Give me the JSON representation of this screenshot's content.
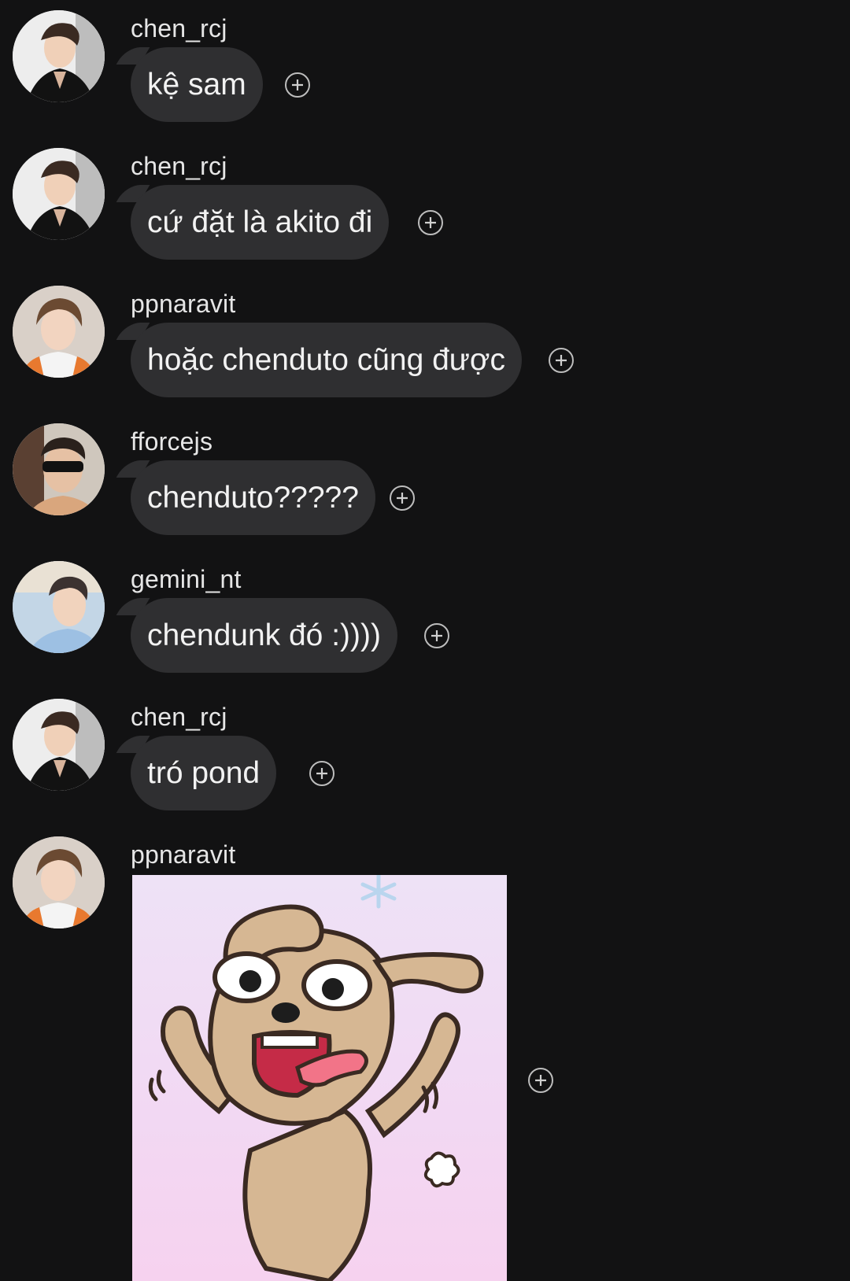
{
  "messages": [
    {
      "user": "chen_rcj",
      "text": "kệ sam",
      "avatar": "avatar-chen-rcj"
    },
    {
      "user": "chen_rcj",
      "text": "cứ đặt là akito đi",
      "avatar": "avatar-chen-rcj"
    },
    {
      "user": "ppnaravit",
      "text": "hoặc chenduto cũng được",
      "avatar": "avatar-ppnaravit"
    },
    {
      "user": "fforcejs",
      "text": "chenduto?????",
      "avatar": "avatar-fforcejs"
    },
    {
      "user": "gemini_nt",
      "text": "chendunk đó :))))",
      "avatar": "avatar-gemini-nt"
    },
    {
      "user": "chen_rcj",
      "text": "tró pond",
      "avatar": "avatar-chen-rcj"
    },
    {
      "user": "ppnaravit",
      "sticker": "dog-sticker",
      "avatar": "avatar-ppnaravit"
    }
  ],
  "icons": {
    "react": "add-reaction-icon"
  },
  "colors": {
    "background": "#121213",
    "bubble": "#2f2f31",
    "text": "#f2f2f2"
  }
}
